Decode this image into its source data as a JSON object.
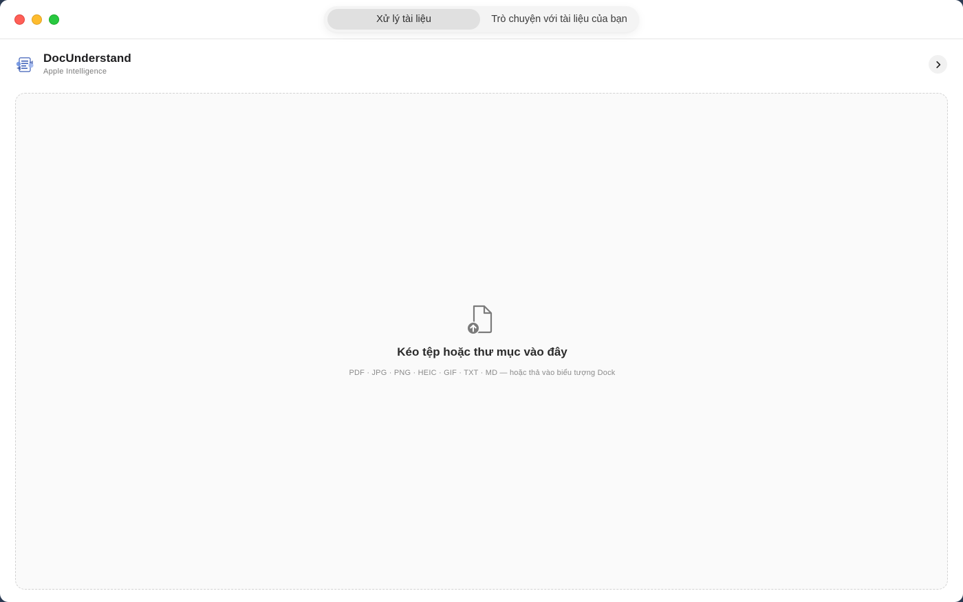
{
  "window": {
    "controls": {
      "close": "close-button",
      "minimize": "minimize-button",
      "zoom": "zoom-button"
    }
  },
  "toolbar": {
    "tabs": [
      {
        "label": "Xử lý tài liệu",
        "selected": true
      },
      {
        "label": "Trò chuyện với tài liệu của bạn",
        "selected": false
      }
    ]
  },
  "header": {
    "app_name": "DocUnderstand",
    "subtitle": "Apple Intelligence",
    "icon": "app-logo-icon",
    "expand_icon": "chevron-right-icon"
  },
  "dropzone": {
    "icon": "document-upload-icon",
    "title": "Kéo tệp hoặc thư mục vào đây",
    "hint": "PDF · JPG · PNG · HEIC · GIF · TXT · MD — hoặc thả vào biểu tượng Dock"
  },
  "colors": {
    "close": "#ff5f57",
    "minimize": "#febc2e",
    "zoom": "#28c840",
    "selected_tab_bg": "#e0e0e0",
    "dropzone_border": "#d2d2d2"
  }
}
